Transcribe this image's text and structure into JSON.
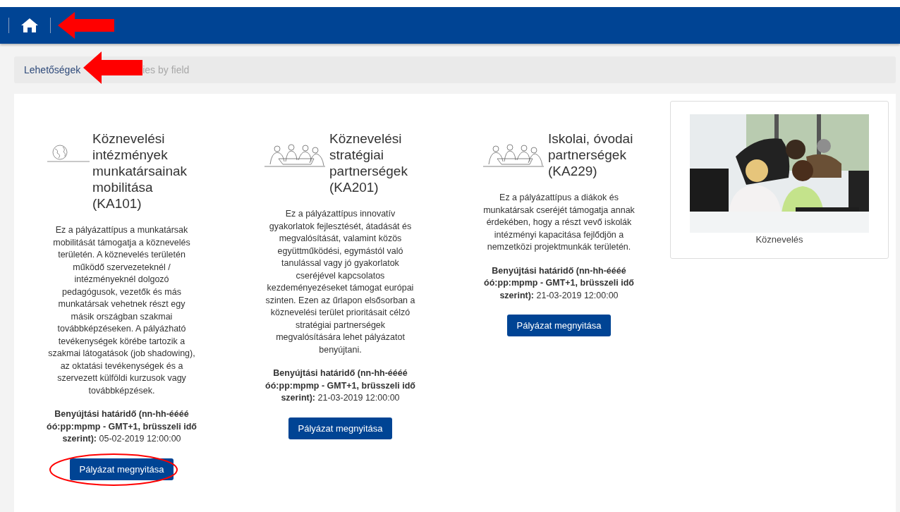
{
  "navbar": {
    "arrow_marker": true
  },
  "breadcrumb": {
    "items": [
      {
        "label": "Lehetőségek",
        "link": true
      },
      {
        "label": "ies by field",
        "link": false
      }
    ],
    "arrow_marker": true
  },
  "programs": [
    {
      "title": "Köznevelési intézmények munkatársainak mobilitása (KA101)",
      "description": "Ez a pályázattípus a munkatársak mobilitását támogatja a köznevelés területén. A köznevelés területén működő szervezeteknél / intézményeknél dolgozó pedagógusok, vezetők és más munkatársak vehetnek részt egy másik országban szakmai továbbképzéseken. A pályázható tevékenységek körébe tartozik a szakmai látogatások (job shadowing), az oktatási tevékenységek és a szervezett külföldi kurzusok vagy továbbképzések.",
      "deadline": "**Benyújtási határidő (nn-hh-éééé óó:pp:mpmp - GMT+1, brüsszeli idő szerint):** 05-02-2019 12:00:00",
      "button": "Pályázat megnyitása",
      "button_circled": true
    },
    {
      "title": "Köznevelési stratégiai partnerségek (KA201)",
      "description": "Ez a pályázattípus innovatív gyakorlatok fejlesztését, átadását és megvalósítását, valamint közös együttműködési, egymástól való tanulással vagy jó gyakorlatok cseréjével kapcsolatos kezdeményezéseket támogat európai szinten. Ezen az űrlapon elsősorban a köznevelési terület prioritásait célzó stratégiai partnerségek megvalósítására lehet pályázatot benyújtani.",
      "deadline": "**Benyújtási határidő (nn-hh-éééé óó:pp:mpmp - GMT+1, brüsszeli idő szerint):** 21-03-2019 12:00:00",
      "button": "Pályázat megnyitása",
      "button_circled": false
    },
    {
      "title": "Iskolai, óvodai partnerségek (KA229)",
      "description": "Ez a pályázattípus a diákok és munkatársak cseréjét támogatja annak érdekében, hogy a részt vevő iskolák intézményi kapacitása fejlődjön a nemzetközi projektmunkák területén.",
      "deadline": "**Benyújtási határidő (nn-hh-éééé óó:pp:mpmp - GMT+1, brüsszeli idő szerint):** 21-03-2019 12:00:00",
      "button": "Pályázat megnyitása",
      "button_circled": false
    }
  ],
  "field_card": {
    "kind": "picture",
    "caption": "Köznevelés"
  }
}
